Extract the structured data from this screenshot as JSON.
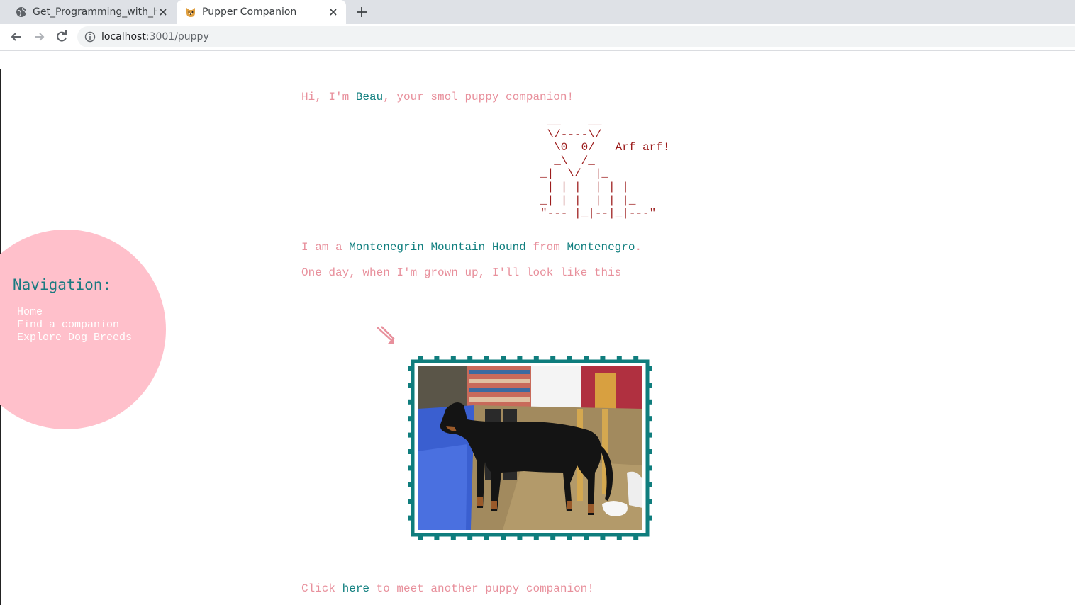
{
  "browser": {
    "tabs": [
      {
        "label": "Get_Programming_with_Haskell",
        "active": false
      },
      {
        "label": "Pupper Companion",
        "active": true
      }
    ],
    "url_host": "localhost",
    "url_rest": ":3001/puppy"
  },
  "nav": {
    "title": "Navigation:",
    "links": [
      "Home",
      "Find a companion",
      "Explore Dog Breeds"
    ]
  },
  "greeting": {
    "prefix": "Hi, I'm ",
    "name": "Beau",
    "suffix": ", your smol puppy companion!"
  },
  "ascii_art": " __    __\n \\/----\\/\n  \\0  0/   Arf arf!\n  _\\  /_\n_|  \\/  |_\n | | |  | | |\n_| | |  | | |_\n\"--- |_|--|_|---\"",
  "breed_line": {
    "prefix": "I am a ",
    "breed": "Montenegrin Mountain Hound",
    "middle": " from ",
    "origin": "Montenegro",
    "suffix": "."
  },
  "grown_line": "One day, when I'm grown up, I'll look like this",
  "footer_line": {
    "prefix": "Click ",
    "link": "here",
    "suffix": " to meet another puppy companion!"
  },
  "colors": {
    "pink_text": "#e8909c",
    "teal_text": "#117f7f",
    "nav_circle": "#ffc0cb",
    "stamp_border": "#0f7d7d",
    "ascii_text": "#9c1c1c"
  },
  "icons": {
    "arrow": "pink-diagonal-arrow-icon",
    "tab_favicon": "globe-icon",
    "active_favicon": "dog-face-icon"
  }
}
